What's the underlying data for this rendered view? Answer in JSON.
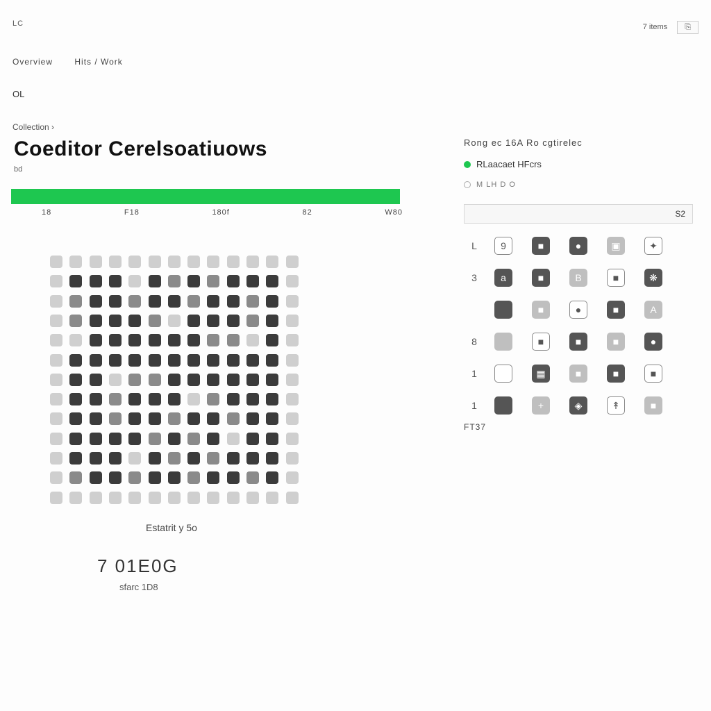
{
  "top": {
    "left_small": "LC",
    "crumb1": "Overview",
    "crumb2": "Hits / Work",
    "right_a": "7 items",
    "right_b": "⎘"
  },
  "ol": "OL",
  "section_label": "Collection ›",
  "title": "Coeditor Cerelsoatiuows",
  "title_sub": "bd",
  "tabs": [
    "18",
    "F18",
    "180f",
    "82",
    "W80"
  ],
  "caption1": "Estatrit y 5o",
  "bignum": "7 01E0G",
  "caption2": "sfarc 1D8",
  "right": {
    "title": "Rong ec 16A  Ro cgtirelec",
    "line1": "RLaacaet HFcrs",
    "line2": "M LH  D O",
    "header_left": "",
    "header_right": "S2",
    "foot": "FT37"
  },
  "palette": {
    "row_labels": [
      "L",
      "3",
      "",
      "8",
      "1",
      "1"
    ],
    "glyphs": [
      [
        "9",
        "■",
        "●",
        "▣",
        "✦"
      ],
      [
        "a",
        "■",
        "B",
        "■",
        "❋"
      ],
      [
        "",
        "■",
        "●",
        "■",
        "A"
      ],
      [
        "",
        "■",
        "■",
        "■",
        "●"
      ],
      [
        "",
        "▦",
        "■",
        "■",
        "■"
      ],
      [
        "",
        "+",
        "◈",
        "↟",
        "■"
      ]
    ]
  },
  "colors": {
    "accent": "#1ec750"
  }
}
